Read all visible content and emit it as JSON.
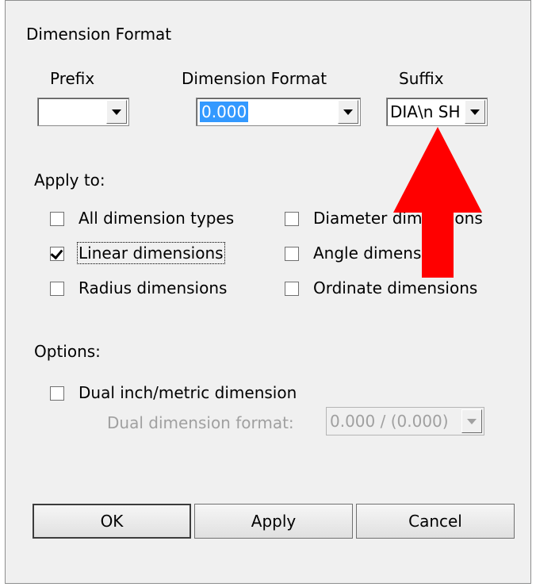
{
  "dialog": {
    "title": "Dimension Format"
  },
  "prefix": {
    "label": "Prefix",
    "value": ""
  },
  "dimension_format": {
    "label": "Dimension Format",
    "value": "0.000"
  },
  "suffix": {
    "label": "Suffix",
    "value": "DIA\\n  SH"
  },
  "apply_to": {
    "heading": "Apply to:",
    "all_types": {
      "label": "All dimension types",
      "checked": false
    },
    "linear": {
      "label": "Linear dimensions",
      "checked": true
    },
    "radius": {
      "label": "Radius dimensions",
      "checked": false
    },
    "diameter": {
      "label": "Diameter dimensions",
      "checked": false
    },
    "angle": {
      "label": "Angle dimensions",
      "checked": false
    },
    "ordinate": {
      "label": "Ordinate dimensions",
      "checked": false
    }
  },
  "options": {
    "heading": "Options:",
    "dual": {
      "label": "Dual inch/metric dimension",
      "checked": false
    },
    "dual_format_label": "Dual dimension format:",
    "dual_format_value": "0.000 / (0.000)"
  },
  "buttons": {
    "ok": "OK",
    "apply": "Apply",
    "cancel": "Cancel"
  },
  "annotation": {
    "color": "#ff0000"
  }
}
